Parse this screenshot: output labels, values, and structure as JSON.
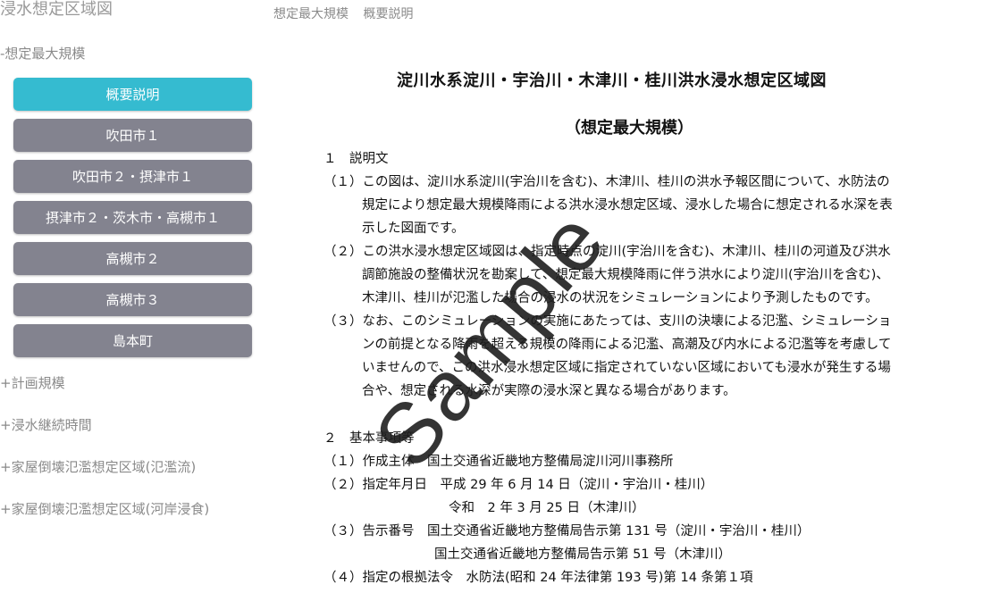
{
  "app": {
    "title": "浸水想定区域図"
  },
  "sidebar": {
    "expanded_section": "-想定最大規模",
    "buttons": [
      {
        "label": "概要説明",
        "active": true
      },
      {
        "label": "吹田市１",
        "active": false
      },
      {
        "label": "吹田市２・摂津市１",
        "active": false
      },
      {
        "label": "摂津市２・茨木市・高槻市１",
        "active": false
      },
      {
        "label": "高槻市２",
        "active": false
      },
      {
        "label": "高槻市３",
        "active": false
      },
      {
        "label": "島本町",
        "active": false
      }
    ],
    "collapsed_sections": [
      "+計画規模",
      "+浸水継続時間",
      "+家屋倒壊氾濫想定区域(氾濫流)",
      "+家屋倒壊氾濫想定区域(河岸浸食)"
    ]
  },
  "breadcrumb": {
    "items": [
      "想定最大規模",
      "概要説明"
    ]
  },
  "document": {
    "title": "淀川水系淀川・宇治川・木津川・桂川洪水浸水想定区域図",
    "subtitle": "（想定最大規模）",
    "heading1": "１　説明文",
    "para1_l1": "（１）この図は、淀川水系淀川(宇治川を含む)、木津川、桂川の洪水予報区間について、水防法の",
    "para1_l2": "規定により想定最大規模降雨による洪水浸水想定区域、浸水した場合に想定される水深を表",
    "para1_l3": "示した図面です。",
    "para2_l1": "（２）この洪水浸水想定区域図は、指定時点の淀川(宇治川を含む)、木津川、桂川の河道及び洪水",
    "para2_l2": "調節施設の整備状況を勘案して、想定最大規模降雨に伴う洪水により淀川(宇治川を含む)、",
    "para2_l3": "木津川、桂川が氾濫した場合の浸水の状況をシミュレーションにより予測したものです。",
    "para3_l1": "（３）なお、このシミュレーションの実施にあたっては、支川の決壊による氾濫、シミュレーショ",
    "para3_l2": "ンの前提となる降雨を超える規模の降雨による氾濫、高潮及び内水による氾濫等を考慮して",
    "para3_l3": "いませんので、この洪水浸水想定区域に指定されていない区域においても浸水が発生する場",
    "para3_l4": "合や、想定される水深が実際の浸水深と異なる場合があります。",
    "heading2": "２　基本事項等",
    "item1": "（１）作成主体　国土交通省近畿地方整備局淀川河川事務所",
    "item2_l1": "（２）指定年月日　平成 29 年 6 月 14 日（淀川・宇治川・桂川）",
    "item2_l2": "令和　2 年 3 月 25 日（木津川）",
    "item3_l1": "（３）告示番号　国土交通省近畿地方整備局告示第 131 号（淀川・宇治川・桂川）",
    "item3_l2": "国土交通省近畿地方整備局告示第 51 号（木津川）",
    "item4": "（４）指定の根拠法令　水防法(昭和 24 年法律第 193 号)第 14 条第１項"
  },
  "watermark": {
    "text": "Sample"
  },
  "colors": {
    "active_button": "#35bbd0",
    "inactive_button": "#83838f"
  }
}
